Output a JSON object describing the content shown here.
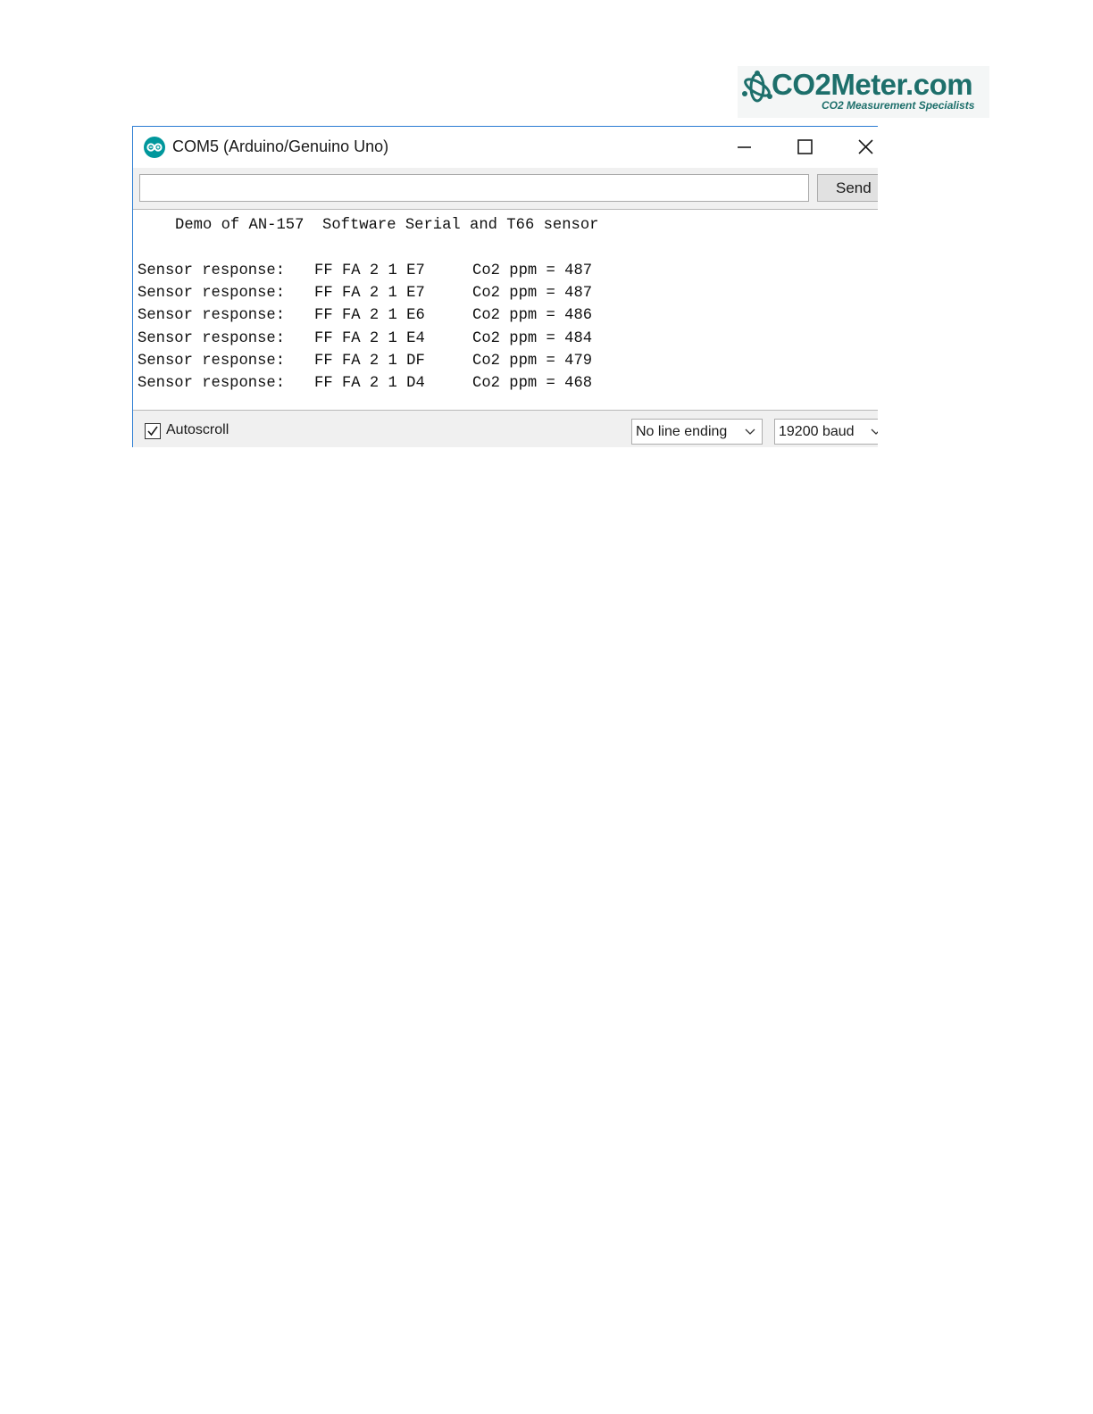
{
  "logo": {
    "name": "CO2Meter.com",
    "tagline": "CO2 Measurement Specialists",
    "mark_icon": "atom-co2-icon"
  },
  "window": {
    "title": "COM5 (Arduino/Genuino Uno)",
    "app_icon": "arduino-infinity-icon",
    "controls": {
      "minimize_icon": "minimize-icon",
      "maximize_icon": "maximize-icon",
      "close_icon": "close-icon"
    }
  },
  "send_bar": {
    "input_value": "",
    "send_label": "Send"
  },
  "serial_output": {
    "header": "Demo of AN-157  Software Serial and T66 sensor",
    "lines": [
      {
        "label": "Sensor response:",
        "bytes": "FF FA 2 1 E7",
        "reading": "Co2 ppm = 487"
      },
      {
        "label": "Sensor response:",
        "bytes": "FF FA 2 1 E7",
        "reading": "Co2 ppm = 487"
      },
      {
        "label": "Sensor response:",
        "bytes": "FF FA 2 1 E6",
        "reading": "Co2 ppm = 486"
      },
      {
        "label": "Sensor response:",
        "bytes": "FF FA 2 1 E4",
        "reading": "Co2 ppm = 484"
      },
      {
        "label": "Sensor response:",
        "bytes": "FF FA 2 1 DF",
        "reading": "Co2 ppm = 479"
      },
      {
        "label": "Sensor response:",
        "bytes": "FF FA 2 1 D4",
        "reading": "Co2 ppm = 468"
      }
    ]
  },
  "status_bar": {
    "autoscroll_label": "Autoscroll",
    "autoscroll_checked": true,
    "line_ending": "No line ending",
    "baud_rate": "19200 baud"
  },
  "colors": {
    "brand": "#1d6f6b",
    "window_border": "#2b7cd3",
    "arduino_icon": "#00979c"
  }
}
